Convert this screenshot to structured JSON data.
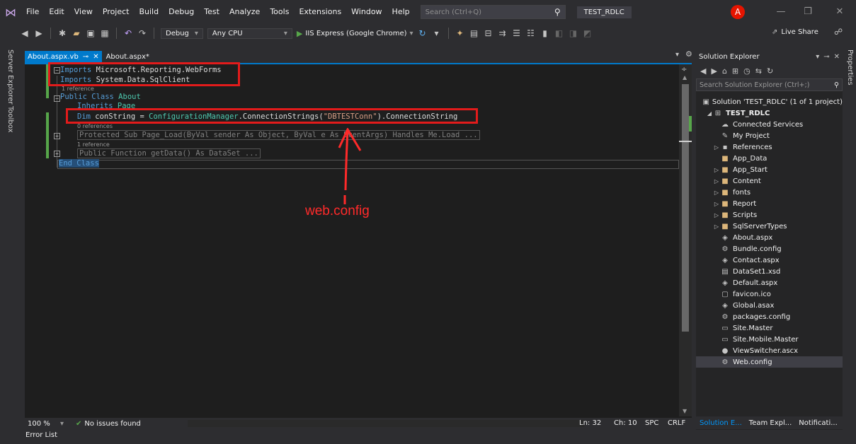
{
  "menu": {
    "items": [
      "File",
      "Edit",
      "View",
      "Project",
      "Build",
      "Debug",
      "Test",
      "Analyze",
      "Tools",
      "Extensions",
      "Window",
      "Help"
    ],
    "search_placeholder": "Search (Ctrl+Q)",
    "solution_name": "TEST_RDLC",
    "account_initial": "A"
  },
  "toolbar": {
    "config": "Debug",
    "platform": "Any CPU",
    "run_label": "IIS Express (Google Chrome)",
    "live_share": "Live Share"
  },
  "left_rail": {
    "server_explorer": "Server Explorer",
    "toolbox": "Toolbox"
  },
  "tabs": {
    "active": "About.aspx.vb",
    "second": "About.aspx*"
  },
  "code": {
    "l1_kw": "Imports",
    "l1_rest": " Microsoft.Reporting.WebForms",
    "l2_kw": "Imports",
    "l2_rest": " System.Data.SqlClient",
    "ref1": "1 reference",
    "l3_kw": "Public Class",
    "l3_name": " About",
    "l4_kw": "Inherits",
    "l4_name": " Page",
    "l5_kw": "Dim",
    "l5_var": " conString = ",
    "l5_type": "ConfigurationManager",
    "l5_mid": ".ConnectionStrings(",
    "l5_str": "\"DBTESTConn\"",
    "l5_end": ").ConnectionString",
    "ref2": "0 references",
    "l6": "Protected Sub Page_Load(ByVal sender As Object, ByVal e As EventArgs) Handles Me.Load ...",
    "ref3": "1 reference",
    "l7": "Public Function getData() As DataSet ...",
    "l8": "End Class"
  },
  "annotation": "web.config",
  "editor_status": {
    "zoom": "100 %",
    "issues": "No issues found",
    "ln": "Ln: 32",
    "ch": "Ch: 10",
    "spc": "SPC",
    "crlf": "CRLF"
  },
  "error_list": "Error List",
  "solution_explorer": {
    "title": "Solution Explorer",
    "search_placeholder": "Search Solution Explorer (Ctrl+;)",
    "tree": [
      {
        "label": "Solution 'TEST_RDLC' (1 of 1 project)",
        "indent": 0,
        "icon": "solution-icon",
        "glyph": "▣",
        "expander": "",
        "kind": "proj"
      },
      {
        "label": "TEST_RDLC",
        "indent": 1,
        "icon": "web-project-icon",
        "glyph": "⊞",
        "expander": "◢",
        "kind": "proj",
        "bold": true
      },
      {
        "label": "Connected Services",
        "indent": 2,
        "icon": "connected-services-icon",
        "glyph": "☁",
        "expander": "",
        "kind": "file"
      },
      {
        "label": "My Project",
        "indent": 2,
        "icon": "wrench-icon",
        "glyph": "✎",
        "expander": "",
        "kind": "file"
      },
      {
        "label": "References",
        "indent": 2,
        "icon": "references-icon",
        "glyph": "▪",
        "expander": "▷",
        "kind": "file"
      },
      {
        "label": "App_Data",
        "indent": 2,
        "icon": "folder-icon",
        "glyph": "■",
        "expander": "",
        "kind": "folder"
      },
      {
        "label": "App_Start",
        "indent": 2,
        "icon": "folder-icon",
        "glyph": "■",
        "expander": "▷",
        "kind": "folder"
      },
      {
        "label": "Content",
        "indent": 2,
        "icon": "folder-icon",
        "glyph": "■",
        "expander": "▷",
        "kind": "folder"
      },
      {
        "label": "fonts",
        "indent": 2,
        "icon": "folder-icon",
        "glyph": "■",
        "expander": "▷",
        "kind": "folder"
      },
      {
        "label": "Report",
        "indent": 2,
        "icon": "folder-icon",
        "glyph": "■",
        "expander": "▷",
        "kind": "folder"
      },
      {
        "label": "Scripts",
        "indent": 2,
        "icon": "folder-icon",
        "glyph": "■",
        "expander": "▷",
        "kind": "folder"
      },
      {
        "label": "SqlServerTypes",
        "indent": 2,
        "icon": "folder-icon",
        "glyph": "■",
        "expander": "▷",
        "kind": "folder"
      },
      {
        "label": "About.aspx",
        "indent": 2,
        "icon": "aspx-file-icon",
        "glyph": "◈",
        "expander": "",
        "kind": "file"
      },
      {
        "label": "Bundle.config",
        "indent": 2,
        "icon": "config-file-icon",
        "glyph": "⚙",
        "expander": "",
        "kind": "file"
      },
      {
        "label": "Contact.aspx",
        "indent": 2,
        "icon": "aspx-file-icon",
        "glyph": "◈",
        "expander": "",
        "kind": "file"
      },
      {
        "label": "DataSet1.xsd",
        "indent": 2,
        "icon": "dataset-file-icon",
        "glyph": "▤",
        "expander": "",
        "kind": "file"
      },
      {
        "label": "Default.aspx",
        "indent": 2,
        "icon": "aspx-file-icon",
        "glyph": "◈",
        "expander": "",
        "kind": "file"
      },
      {
        "label": "favicon.ico",
        "indent": 2,
        "icon": "image-file-icon",
        "glyph": "▢",
        "expander": "",
        "kind": "file"
      },
      {
        "label": "Global.asax",
        "indent": 2,
        "icon": "asax-file-icon",
        "glyph": "◈",
        "expander": "",
        "kind": "file"
      },
      {
        "label": "packages.config",
        "indent": 2,
        "icon": "config-file-icon",
        "glyph": "⚙",
        "expander": "",
        "kind": "file"
      },
      {
        "label": "Site.Master",
        "indent": 2,
        "icon": "master-file-icon",
        "glyph": "▭",
        "expander": "",
        "kind": "file"
      },
      {
        "label": "Site.Mobile.Master",
        "indent": 2,
        "icon": "master-file-icon",
        "glyph": "▭",
        "expander": "",
        "kind": "file"
      },
      {
        "label": "ViewSwitcher.ascx",
        "indent": 2,
        "icon": "user-control-icon",
        "glyph": "●",
        "expander": "",
        "kind": "file"
      },
      {
        "label": "Web.config",
        "indent": 2,
        "icon": "config-file-icon",
        "glyph": "⚙",
        "expander": "",
        "kind": "file",
        "selected": true
      }
    ],
    "tabs": [
      "Solution E...",
      "Team Expl...",
      "Notificati..."
    ]
  },
  "right_rail": {
    "properties": "Properties"
  },
  "colors": {
    "accent": "#007acc",
    "annotation_red": "#e21b1b",
    "keyword": "#569cd6",
    "type": "#4ec9b0",
    "string": "#d69d85"
  }
}
